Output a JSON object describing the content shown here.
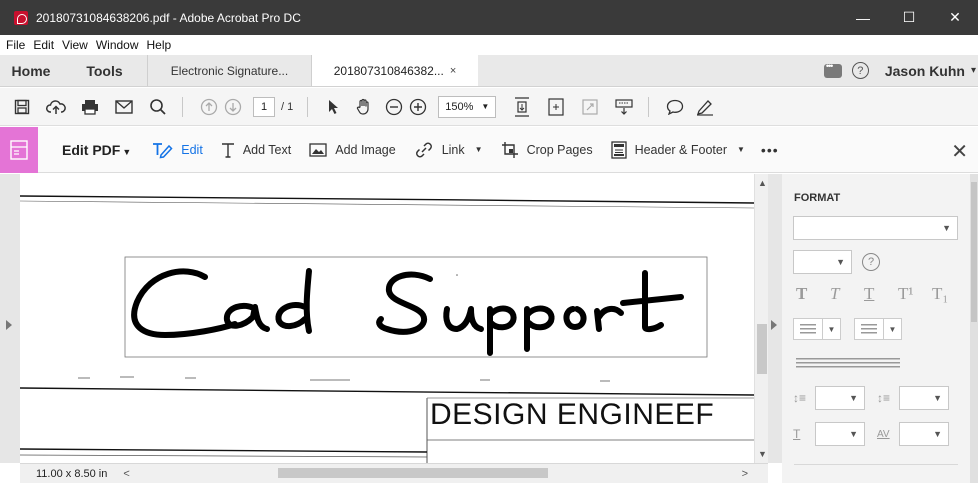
{
  "window": {
    "title": "20180731084638206.pdf - Adobe Acrobat Pro DC",
    "controls": {
      "minimize": "—",
      "maximize": "☐",
      "close": "✕"
    }
  },
  "menu": [
    "File",
    "Edit",
    "View",
    "Window",
    "Help"
  ],
  "tabs": {
    "home": "Home",
    "tools": "Tools",
    "doc1": "Electronic Signature...",
    "doc2": "201807310846382...",
    "doc2_close": "×",
    "help": "?",
    "user": "Jason Kuhn"
  },
  "toolbar": {
    "page_current": "1",
    "page_total": "/ 1",
    "zoom": "150%"
  },
  "editbar": {
    "title": "Edit PDF",
    "items": {
      "edit": "Edit",
      "add_text": "Add Text",
      "add_image": "Add Image",
      "link": "Link",
      "crop": "Crop Pages",
      "header_footer": "Header & Footer",
      "more": "•••"
    }
  },
  "document": {
    "signature_text": "Cad Support",
    "title_block_text": "DESIGN ENGINEEF"
  },
  "status": {
    "page_size": "11.00 x 8.50 in"
  },
  "panel": {
    "section": "FORMAT",
    "help": "?",
    "text_styles": [
      "T",
      "T",
      "T",
      "T¹",
      "T₁"
    ],
    "spacing_labels": {
      "char": "AV"
    }
  },
  "colors": {
    "titlebar": "#3a3a3a",
    "edit_accent": "#e474d6",
    "link_blue": "#1473e6"
  }
}
